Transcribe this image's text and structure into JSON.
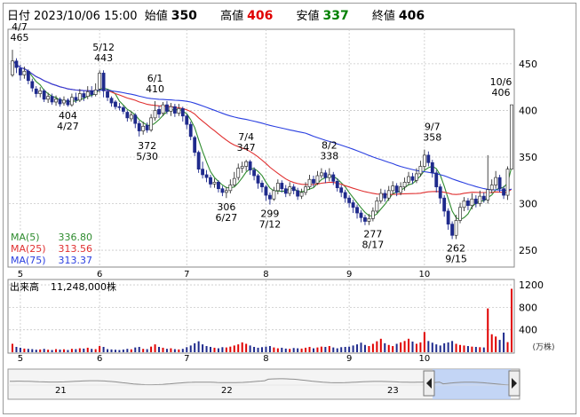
{
  "header": {
    "date_label": "日付",
    "datetime": "2023/10/06 15:00",
    "open_label": "始値",
    "open": "350",
    "high_label": "高値",
    "high": "406",
    "low_label": "安値",
    "low": "337",
    "close_label": "終値",
    "close": "406"
  },
  "colors": {
    "up": "#e00000",
    "down": "#1f2a8c",
    "ma5": "#2e8b2e",
    "ma25": "#e03030",
    "ma75": "#2a3fe0",
    "grid": "#c8c8c8"
  },
  "ma_legend": [
    {
      "label": "MA(5)",
      "value": "336.80",
      "color": "#2e8b2e"
    },
    {
      "label": "MA(25)",
      "value": "313.56",
      "color": "#e03030"
    },
    {
      "label": "MA(75)",
      "value": "313.37",
      "color": "#2a3fe0"
    }
  ],
  "volume_legend": {
    "label": "出来高",
    "value": "11,248,000株"
  },
  "volume_unit": "(万株)",
  "timeline_year_labels": [
    "21",
    "22",
    "23"
  ],
  "chart_data": [
    {
      "type": "candlestick",
      "y_ticks": [
        250,
        300,
        350,
        400,
        450
      ],
      "ylim": [
        232,
        487
      ],
      "month_labels": [
        {
          "label": "5",
          "day": 2
        },
        {
          "label": "6",
          "day": 22
        },
        {
          "label": "7",
          "day": 44
        },
        {
          "label": "8",
          "day": 64
        },
        {
          "label": "9",
          "day": 85
        },
        {
          "label": "10",
          "day": 104
        }
      ],
      "annotations": [
        {
          "date": "4/7",
          "value": "465",
          "day": 0,
          "price": 465,
          "pos": "above"
        },
        {
          "date": "4/27",
          "value": "404",
          "day": 14,
          "price": 404,
          "pos": "below"
        },
        {
          "date": "5/12",
          "value": "443",
          "day": 23,
          "price": 443,
          "pos": "above"
        },
        {
          "date": "5/30",
          "value": "372",
          "day": 34,
          "price": 372,
          "pos": "below"
        },
        {
          "date": "6/1",
          "value": "410",
          "day": 36,
          "price": 410,
          "pos": "above"
        },
        {
          "date": "6/27",
          "value": "306",
          "day": 54,
          "price": 306,
          "pos": "below"
        },
        {
          "date": "7/4",
          "value": "347",
          "day": 59,
          "price": 347,
          "pos": "above"
        },
        {
          "date": "7/12",
          "value": "299",
          "day": 65,
          "price": 299,
          "pos": "below"
        },
        {
          "date": "8/2",
          "value": "338",
          "day": 80,
          "price": 338,
          "pos": "above"
        },
        {
          "date": "8/17",
          "value": "277",
          "day": 91,
          "price": 277,
          "pos": "below"
        },
        {
          "date": "9/7",
          "value": "358",
          "day": 106,
          "price": 358,
          "pos": "above"
        },
        {
          "date": "9/15",
          "value": "262",
          "day": 112,
          "price": 262,
          "pos": "below"
        },
        {
          "date": "10/6",
          "value": "406",
          "day": 126,
          "price": 406,
          "pos": "above"
        }
      ],
      "candles": [
        [
          0,
          438,
          453,
          465,
          436
        ],
        [
          1,
          453,
          446,
          456,
          440
        ],
        [
          2,
          445,
          438,
          449,
          432
        ],
        [
          3,
          438,
          442,
          447,
          434
        ],
        [
          4,
          442,
          432,
          444,
          428
        ],
        [
          5,
          431,
          424,
          434,
          420
        ],
        [
          6,
          423,
          418,
          426,
          414
        ],
        [
          7,
          418,
          421,
          425,
          414
        ],
        [
          8,
          421,
          412,
          423,
          409
        ],
        [
          9,
          412,
          415,
          419,
          408
        ],
        [
          10,
          415,
          409,
          418,
          406
        ],
        [
          11,
          409,
          412,
          416,
          405
        ],
        [
          12,
          412,
          407,
          414,
          404
        ],
        [
          13,
          408,
          411,
          415,
          405
        ],
        [
          14,
          411,
          406,
          413,
          404
        ],
        [
          15,
          406,
          414,
          418,
          404
        ],
        [
          16,
          414,
          411,
          419,
          408
        ],
        [
          17,
          411,
          418,
          423,
          409
        ],
        [
          18,
          418,
          414,
          421,
          410
        ],
        [
          19,
          415,
          420,
          426,
          412
        ],
        [
          20,
          421,
          417,
          426,
          414
        ],
        [
          21,
          417,
          422,
          429,
          415
        ],
        [
          22,
          423,
          440,
          443,
          419
        ],
        [
          23,
          440,
          421,
          443,
          414
        ],
        [
          24,
          420,
          414,
          423,
          410
        ],
        [
          25,
          413,
          408,
          415,
          404
        ],
        [
          26,
          409,
          404,
          411,
          401
        ],
        [
          27,
          404,
          403,
          408,
          400
        ],
        [
          28,
          403,
          399,
          405,
          396
        ],
        [
          29,
          398,
          392,
          400,
          388
        ],
        [
          30,
          391,
          395,
          399,
          388
        ],
        [
          31,
          395,
          386,
          397,
          381
        ],
        [
          32,
          386,
          378,
          389,
          372
        ],
        [
          33,
          378,
          383,
          388,
          374
        ],
        [
          34,
          384,
          379,
          387,
          376
        ],
        [
          35,
          379,
          392,
          396,
          377
        ],
        [
          36,
          392,
          400,
          410,
          389
        ],
        [
          37,
          401,
          396,
          405,
          392
        ],
        [
          38,
          397,
          406,
          409,
          394
        ],
        [
          39,
          406,
          399,
          410,
          396
        ],
        [
          40,
          399,
          404,
          408,
          394
        ],
        [
          41,
          404,
          397,
          407,
          393
        ],
        [
          42,
          397,
          402,
          407,
          394
        ],
        [
          43,
          402,
          394,
          404,
          388
        ],
        [
          44,
          394,
          385,
          396,
          380
        ],
        [
          45,
          385,
          372,
          388,
          368
        ],
        [
          46,
          371,
          355,
          373,
          351
        ],
        [
          47,
          355,
          337,
          357,
          333
        ],
        [
          48,
          337,
          331,
          345,
          327
        ],
        [
          49,
          331,
          328,
          336,
          323
        ],
        [
          50,
          328,
          321,
          331,
          317
        ],
        [
          51,
          321,
          323,
          327,
          317
        ],
        [
          52,
          323,
          316,
          325,
          312
        ],
        [
          53,
          316,
          312,
          319,
          308
        ],
        [
          54,
          312,
          314,
          318,
          306
        ],
        [
          55,
          314,
          320,
          326,
          311
        ],
        [
          56,
          320,
          327,
          334,
          318
        ],
        [
          57,
          328,
          338,
          343,
          325
        ],
        [
          58,
          338,
          340,
          345,
          333
        ],
        [
          59,
          340,
          345,
          347,
          335
        ],
        [
          60,
          345,
          336,
          347,
          331
        ],
        [
          61,
          336,
          330,
          339,
          325
        ],
        [
          62,
          330,
          322,
          332,
          316
        ],
        [
          63,
          322,
          318,
          325,
          312
        ],
        [
          64,
          318,
          309,
          320,
          303
        ],
        [
          65,
          309,
          305,
          312,
          299
        ],
        [
          66,
          305,
          314,
          318,
          303
        ],
        [
          67,
          314,
          322,
          326,
          310
        ],
        [
          68,
          322,
          316,
          325,
          312
        ],
        [
          69,
          316,
          311,
          320,
          307
        ],
        [
          70,
          311,
          318,
          323,
          308
        ],
        [
          71,
          318,
          314,
          321,
          310
        ],
        [
          72,
          314,
          308,
          317,
          304
        ],
        [
          73,
          308,
          312,
          316,
          305
        ],
        [
          74,
          312,
          318,
          323,
          309
        ],
        [
          75,
          318,
          326,
          331,
          315
        ],
        [
          76,
          326,
          322,
          330,
          318
        ],
        [
          77,
          322,
          330,
          335,
          320
        ],
        [
          78,
          330,
          333,
          338,
          327
        ],
        [
          79,
          333,
          328,
          336,
          322
        ],
        [
          80,
          328,
          331,
          338,
          324
        ],
        [
          81,
          331,
          324,
          334,
          320
        ],
        [
          82,
          324,
          317,
          327,
          313
        ],
        [
          83,
          317,
          312,
          320,
          307
        ],
        [
          84,
          312,
          306,
          315,
          301
        ],
        [
          85,
          306,
          301,
          309,
          296
        ],
        [
          86,
          301,
          296,
          304,
          290
        ],
        [
          87,
          296,
          290,
          299,
          284
        ],
        [
          88,
          290,
          285,
          293,
          280
        ],
        [
          89,
          285,
          281,
          288,
          277
        ],
        [
          90,
          281,
          284,
          289,
          277
        ],
        [
          91,
          284,
          292,
          296,
          281
        ],
        [
          92,
          292,
          303,
          307,
          290
        ],
        [
          93,
          303,
          311,
          316,
          300
        ],
        [
          94,
          311,
          306,
          315,
          302
        ],
        [
          95,
          306,
          314,
          319,
          303
        ],
        [
          96,
          314,
          319,
          324,
          310
        ],
        [
          97,
          319,
          312,
          322,
          308
        ],
        [
          98,
          312,
          318,
          323,
          309
        ],
        [
          99,
          318,
          323,
          328,
          314
        ],
        [
          100,
          323,
          329,
          334,
          320
        ],
        [
          101,
          329,
          325,
          333,
          321
        ],
        [
          102,
          325,
          332,
          338,
          322
        ],
        [
          103,
          332,
          340,
          346,
          329
        ],
        [
          104,
          340,
          352,
          358,
          336
        ],
        [
          105,
          352,
          344,
          356,
          340
        ],
        [
          106,
          344,
          333,
          347,
          328
        ],
        [
          107,
          333,
          318,
          336,
          312
        ],
        [
          108,
          318,
          306,
          321,
          300
        ],
        [
          109,
          306,
          292,
          309,
          286
        ],
        [
          110,
          292,
          278,
          295,
          272
        ],
        [
          111,
          278,
          266,
          281,
          262
        ],
        [
          112,
          266,
          282,
          288,
          262
        ],
        [
          113,
          282,
          296,
          301,
          279
        ],
        [
          114,
          296,
          303,
          307,
          292
        ],
        [
          115,
          303,
          298,
          306,
          293
        ],
        [
          116,
          298,
          305,
          311,
          294
        ],
        [
          117,
          305,
          300,
          309,
          296
        ],
        [
          118,
          300,
          308,
          314,
          297
        ],
        [
          119,
          308,
          304,
          312,
          301
        ],
        [
          120,
          304,
          315,
          352,
          300
        ],
        [
          121,
          315,
          320,
          326,
          311
        ],
        [
          122,
          320,
          328,
          335,
          316
        ],
        [
          123,
          328,
          316,
          331,
          312
        ],
        [
          124,
          316,
          309,
          319,
          305
        ],
        [
          125,
          309,
          337,
          340,
          304
        ],
        [
          126,
          337,
          406,
          406,
          337
        ]
      ]
    },
    {
      "type": "bar",
      "y_ticks": [
        400,
        800,
        1200
      ],
      "ylim": [
        0,
        1280
      ],
      "unit": "万株",
      "month_labels": [
        {
          "label": "5",
          "day": 2
        },
        {
          "label": "6",
          "day": 22
        },
        {
          "label": "7",
          "day": 44
        },
        {
          "label": "8",
          "day": 64
        },
        {
          "label": "9",
          "day": 85
        },
        {
          "label": "10",
          "day": 104
        }
      ],
      "volumes": [
        150,
        95,
        80,
        65,
        60,
        55,
        45,
        50,
        60,
        45,
        40,
        55,
        48,
        52,
        40,
        60,
        55,
        70,
        65,
        80,
        60,
        55,
        110,
        95,
        55,
        50,
        45,
        40,
        48,
        60,
        52,
        85,
        95,
        60,
        55,
        100,
        140,
        95,
        80,
        60,
        70,
        55,
        50,
        60,
        90,
        120,
        160,
        195,
        140,
        110,
        95,
        80,
        70,
        90,
        85,
        100,
        120,
        140,
        175,
        150,
        120,
        95,
        80,
        90,
        100,
        110,
        85,
        70,
        80,
        65,
        60,
        75,
        70,
        65,
        80,
        95,
        70,
        85,
        100,
        95,
        110,
        85,
        70,
        90,
        95,
        100,
        120,
        140,
        170,
        130,
        110,
        150,
        195,
        240,
        160,
        130,
        110,
        150,
        175,
        200,
        240,
        190,
        150,
        175,
        360,
        200,
        170,
        140,
        120,
        160,
        175,
        200,
        150,
        130,
        120,
        110,
        100,
        95,
        90,
        85,
        780,
        320,
        280,
        220,
        350,
        180,
        1130
      ]
    }
  ]
}
